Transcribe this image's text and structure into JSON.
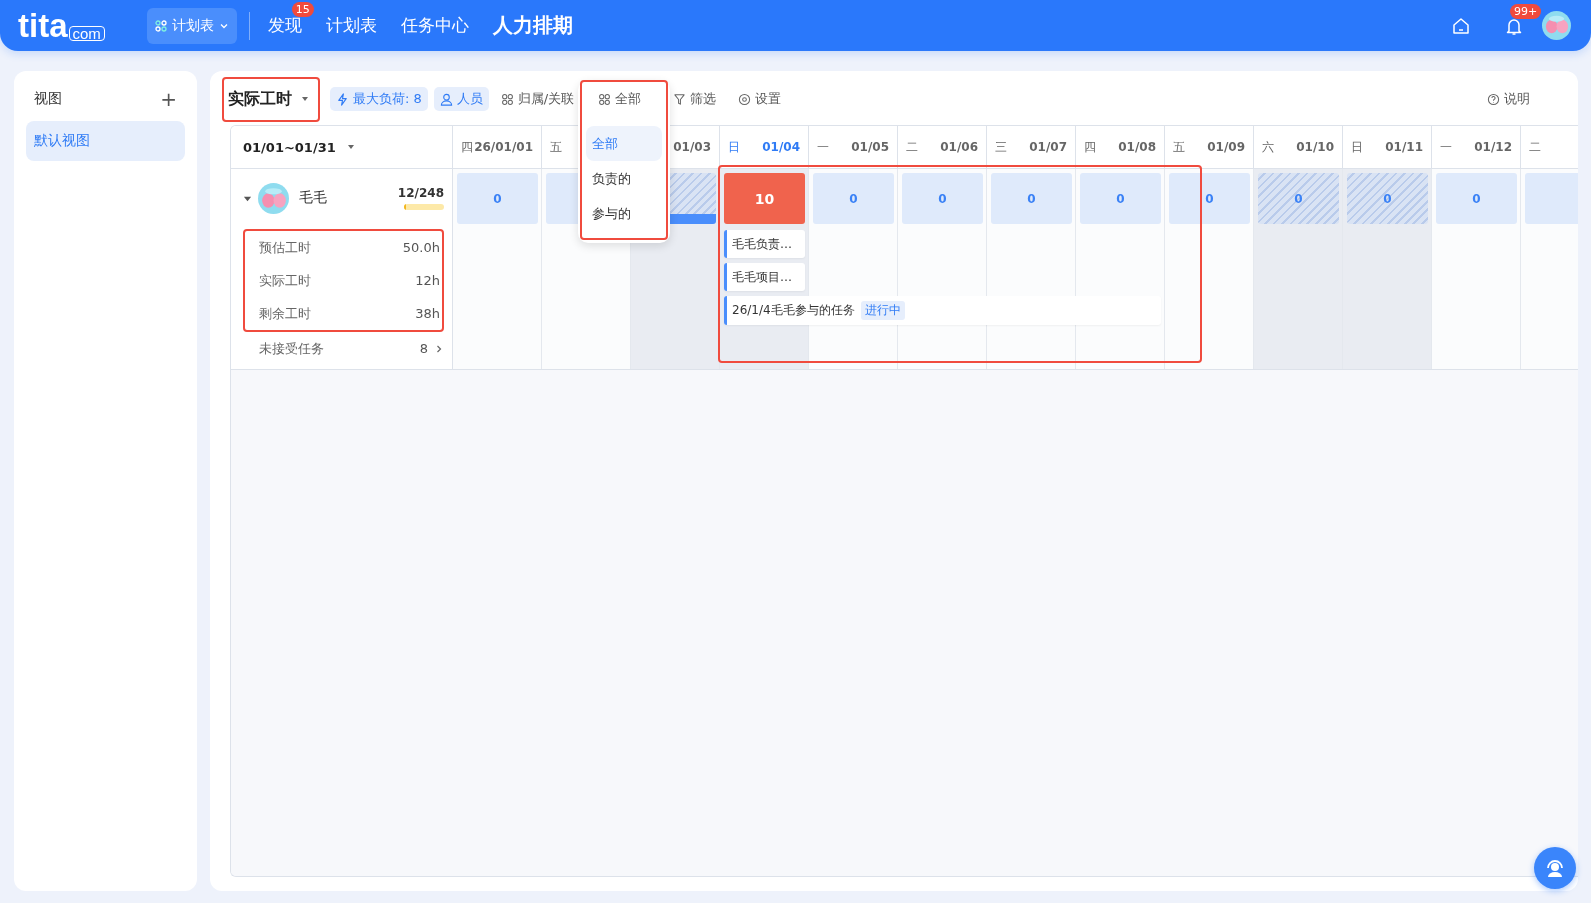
{
  "nav": {
    "logo": "tita",
    "logo_suffix": "com",
    "menu": {
      "label": "计划表"
    },
    "links": [
      {
        "label": "发现",
        "badge": "15",
        "selected": false
      },
      {
        "label": "计划表",
        "selected": false
      },
      {
        "label": "任务中心",
        "selected": false
      },
      {
        "label": "人力排期",
        "selected": true
      }
    ],
    "notifications_badge": "99+"
  },
  "sidebar": {
    "title": "视图",
    "add": "+",
    "items": [
      {
        "label": "默认视图",
        "selected": true
      }
    ]
  },
  "toolbar": {
    "title": "实际工时",
    "chips": [
      {
        "label": "最大负荷: 8",
        "kind": "load"
      },
      {
        "label": "人员",
        "kind": "person"
      }
    ],
    "actions": [
      {
        "label": "归属/关联",
        "kind": "grid"
      },
      {
        "label": "全部",
        "kind": "grid",
        "menu": [
          {
            "label": "全部",
            "selected": true
          },
          {
            "label": "负责的",
            "selected": false
          },
          {
            "label": "参与的",
            "selected": false
          }
        ]
      },
      {
        "label": "筛选",
        "kind": "filter"
      },
      {
        "label": "设置",
        "kind": "gear"
      }
    ],
    "help": "说明"
  },
  "range": "01/01~01/31",
  "columns": [
    {
      "weekday": "四",
      "date": "26/01/01",
      "load": "0",
      "weekend": false,
      "today": false,
      "over": false
    },
    {
      "weekday": "五",
      "weekend": false,
      "today": false,
      "over": false
    },
    {
      "date": "01/03",
      "weekend": true,
      "today": false,
      "over": false,
      "bar": true
    },
    {
      "weekday": "日",
      "date": "01/04",
      "load": "10",
      "weekend": true,
      "today": true,
      "over": true,
      "tasks": [
        {
          "title": "毛毛负责…",
          "kind": "chip"
        },
        {
          "title": "毛毛项目…",
          "kind": "chip"
        },
        {
          "title": "26/1/4毛毛参与的任务",
          "status": "进行中",
          "kind": "week"
        }
      ]
    },
    {
      "weekday": "一",
      "date": "01/05",
      "load": "0",
      "weekend": false,
      "today": false,
      "over": false
    },
    {
      "weekday": "二",
      "date": "01/06",
      "load": "0",
      "weekend": false,
      "today": false,
      "over": false
    },
    {
      "weekday": "三",
      "date": "01/07",
      "load": "0",
      "weekend": false,
      "today": false,
      "over": false
    },
    {
      "weekday": "四",
      "date": "01/08",
      "load": "0",
      "weekend": false,
      "today": false,
      "over": false
    },
    {
      "weekday": "五",
      "date": "01/09",
      "load": "0",
      "weekend": false,
      "today": false,
      "over": false
    },
    {
      "weekday": "六",
      "date": "01/10",
      "load": "0",
      "weekend": true,
      "today": false,
      "over": false
    },
    {
      "weekday": "日",
      "date": "01/11",
      "load": "0",
      "weekend": true,
      "today": false,
      "over": false
    },
    {
      "weekday": "一",
      "date": "01/12",
      "load": "0",
      "weekend": false,
      "today": false,
      "over": false
    },
    {
      "weekday": "二",
      "weekend": false,
      "today": false,
      "over": false
    }
  ],
  "person": {
    "name": "毛毛",
    "expanded": true,
    "load_text": "12/248",
    "level": 0.05,
    "stats": [
      {
        "label": "预估工时",
        "value": "50.0h"
      },
      {
        "label": "实际工时",
        "value": "12h"
      },
      {
        "label": "剩余工时",
        "value": "38h"
      }
    ],
    "pending": {
      "label": "未接受任务",
      "value": "8"
    }
  }
}
